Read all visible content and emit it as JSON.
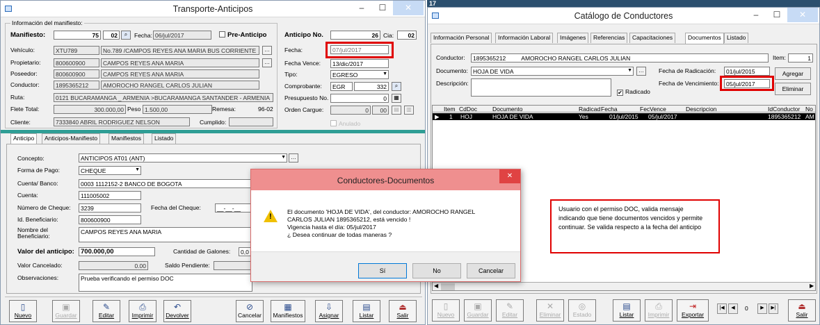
{
  "left_window": {
    "title": "Transporte-Anticipos",
    "manifest_group": "Información del manifiesto:",
    "manifiesto_label": "Manifiesto:",
    "manifiesto_num": "75",
    "manifiesto_code": "02",
    "fecha_label": "Fecha:",
    "fecha_value": "06/jul/2017",
    "pre_anticipo_label": "Pre-Anticipo",
    "vehiculo_label": "Vehículo:",
    "vehiculo_plate": "XTU789",
    "vehiculo_desc": "No.789 /CAMPOS REYES ANA MARIA BUS CORRIENTE",
    "propietario_label": "Propietario:",
    "propietario_id": "800600900",
    "propietario_name": "CAMPOS REYES ANA MARIA",
    "poseedor_label": "Poseedor:",
    "poseedor_id": "800600900",
    "poseedor_name": "CAMPOS REYES ANA MARIA",
    "conductor_label": "Conductor:",
    "conductor_id": "1895365212",
    "conductor_name": "AMOROCHO RANGEL CARLOS JULIAN",
    "ruta_label": "Ruta:",
    "ruta_value": "0121 BUCARAMANGA _ ARMENIA >BUCARAMANGA SANTANDER - ARMENIA",
    "flete_label": "Flete Total:",
    "flete_value": "300.000,00",
    "peso_label": "Peso",
    "peso_value": "1.500,00",
    "remesa_label": "Remesa:",
    "remesa_value": "96-02",
    "cliente_label": "Cliente:",
    "cliente_value": "7333840 ABRIL RODRIGUEZ NELSON",
    "cumplido_label": "Cumplido:",
    "anticipo_no_label": "Anticipo No.",
    "anticipo_no_value": "26",
    "cia_label": "Cia:",
    "cia_value": "02",
    "a_fecha_label": "Fecha:",
    "a_fecha_value": "07/jul/2017",
    "fecha_vence_label": "Fecha Vence:",
    "fecha_vence_value": "13/dic/2017",
    "tipo_label": "Tipo:",
    "tipo_value": "EGRESO",
    "comprobante_label": "Comprobante:",
    "comprobante_code": "EGR",
    "comprobante_num": "332",
    "presupuesto_label": "Presupuesto No.",
    "presupuesto_value": "0",
    "orden_label": "Orden Cargue:",
    "orden_value1": "0",
    "orden_value2": "00",
    "anulado_label": "Anulado",
    "tabs": [
      "Anticipo",
      "Anticipos-Manifiesto",
      "Manifiestos",
      "Listado"
    ],
    "concepto_label": "Concepto:",
    "concepto_value": "ANTICIPOS AT01 (ANT)",
    "forma_pago_label": "Forma de Pago:",
    "forma_pago_value": "CHEQUE",
    "cuenta_banco_label": "Cuenta/ Banco:",
    "cuenta_banco_value": "0003 1112152-2 BANCO DE BOGOTA",
    "cuenta_label": "Cuenta:",
    "cuenta_value": "111005002",
    "num_cheque_label": "Número de Cheque:",
    "num_cheque_value": "3239",
    "fecha_cheque_label": "Fecha del Cheque:",
    "fecha_cheque_value": "__-__-__",
    "id_benef_label": "Id. Beneficiario:",
    "id_benef_value": "800600900",
    "nombre_benef_label1": "Nombre del",
    "nombre_benef_label2": "Beneficiario:",
    "nombre_benef_value": "CAMPOS REYES ANA MARIA",
    "valor_anticipo_label": "Valor del anticipo:",
    "valor_anticipo_value": "700.000,00",
    "cantidad_galones_label": "Cantidad de Galones:",
    "cantidad_galones_value": "0,0",
    "valor_cancelado_label": "Valor Cancelado:",
    "valor_cancelado_value": "0.00",
    "saldo_label": "Saldo Pendiente:",
    "observaciones_label": "Observaciones:",
    "observaciones_value": "Prueba verificando el permiso DOC",
    "toolbar": [
      {
        "icon": "▯",
        "label": "Nuevo",
        "dis": false
      },
      {
        "icon": "▣",
        "label": "Guardar",
        "dis": true
      },
      {
        "icon": "✎",
        "label": "Editar",
        "dis": false
      },
      {
        "icon": "⎙",
        "label": "Imprimir",
        "dis": false
      },
      {
        "icon": "↶",
        "label": "Devolver",
        "dis": false
      },
      {
        "icon": "⊘",
        "label": "Cancelar",
        "dis": false
      },
      {
        "icon": "▦",
        "label": "Manifiestos",
        "dis": false
      },
      {
        "icon": "⇩",
        "label": "Asignar",
        "dis": false
      },
      {
        "icon": "▤",
        "label": "Listar",
        "dis": false
      },
      {
        "icon": "⏏",
        "label": "Salir",
        "dis": false
      }
    ]
  },
  "right_window": {
    "number": "17",
    "title": "Catálogo de Conductores",
    "tabs": [
      "Información Personal",
      "Información Laboral",
      "Imágenes",
      "Referencias",
      "Capacitaciones",
      "Documentos",
      "Listado"
    ],
    "conductor_label": "Conductor:",
    "conductor_id": "1895365212",
    "conductor_name": "AMOROCHO RANGEL  CARLOS JULIAN",
    "item_label": "Item:",
    "item_value": "1",
    "documento_label": "Documento:",
    "documento_value": "HOJA DE VIDA",
    "fecha_radicacion_label": "Fecha de Radicación:",
    "fecha_radicacion_value": "01/jul/2015",
    "agregar_label": "Agregar",
    "descripcion_label": "Descripción:",
    "fecha_vencimiento_label": "Fecha de Vencimiento:",
    "fecha_vencimiento_value": "05/jul/2017",
    "eliminar_label": "Eliminar",
    "radicado_label": "Radicado",
    "grid_headers": [
      "Item",
      "CdDoc",
      "Documento",
      "Radicad",
      "Fecha",
      "FecVence",
      "Descripcion",
      "IdConductor",
      "No"
    ],
    "grid_row": [
      "1",
      "HOJ",
      "HOJA DE VIDA",
      "Yes",
      "01/jul/2015",
      "05/jul/2017",
      "",
      "1895365212",
      "AM"
    ],
    "note_text": "Usuario con el permiso DOC, valida mensaje indicando que tiene documentos vencidos y permite continuar. Se valida respecto a la fecha del anticipo",
    "nav_value": "0",
    "toolbar": [
      {
        "icon": "▯",
        "label": "Nuevo",
        "dis": true
      },
      {
        "icon": "▣",
        "label": "Guardar",
        "dis": true
      },
      {
        "icon": "✎",
        "label": "Editar",
        "dis": true
      },
      {
        "icon": "✕",
        "label": "Eliminar",
        "dis": true
      },
      {
        "icon": "◎",
        "label": "Estado",
        "dis": true
      },
      {
        "icon": "▤",
        "label": "Listar",
        "dis": false
      },
      {
        "icon": "⎙",
        "label": "Imprimir",
        "dis": true
      },
      {
        "icon": "⇥",
        "label": "Exportar",
        "dis": false
      },
      {
        "icon": "⏏",
        "label": "Salir",
        "dis": false
      }
    ]
  },
  "dialog": {
    "title": "Conductores-Documentos",
    "message": "El documento 'HOJA DE VIDA', del conductor: AMOROCHO RANGEL\nCARLOS JULIAN 1895365212, está vencido !\nVigencia hasta el día: 05/jul/2017\n¿ Desea continuar de todas maneras ?",
    "yes_label": "Sí",
    "no_label": "No",
    "cancel_label": "Cancelar"
  },
  "colors": {
    "accent_teal": "#2f9e95",
    "highlight_red": "#e00000",
    "dialog_title": "#ef8f8f"
  }
}
